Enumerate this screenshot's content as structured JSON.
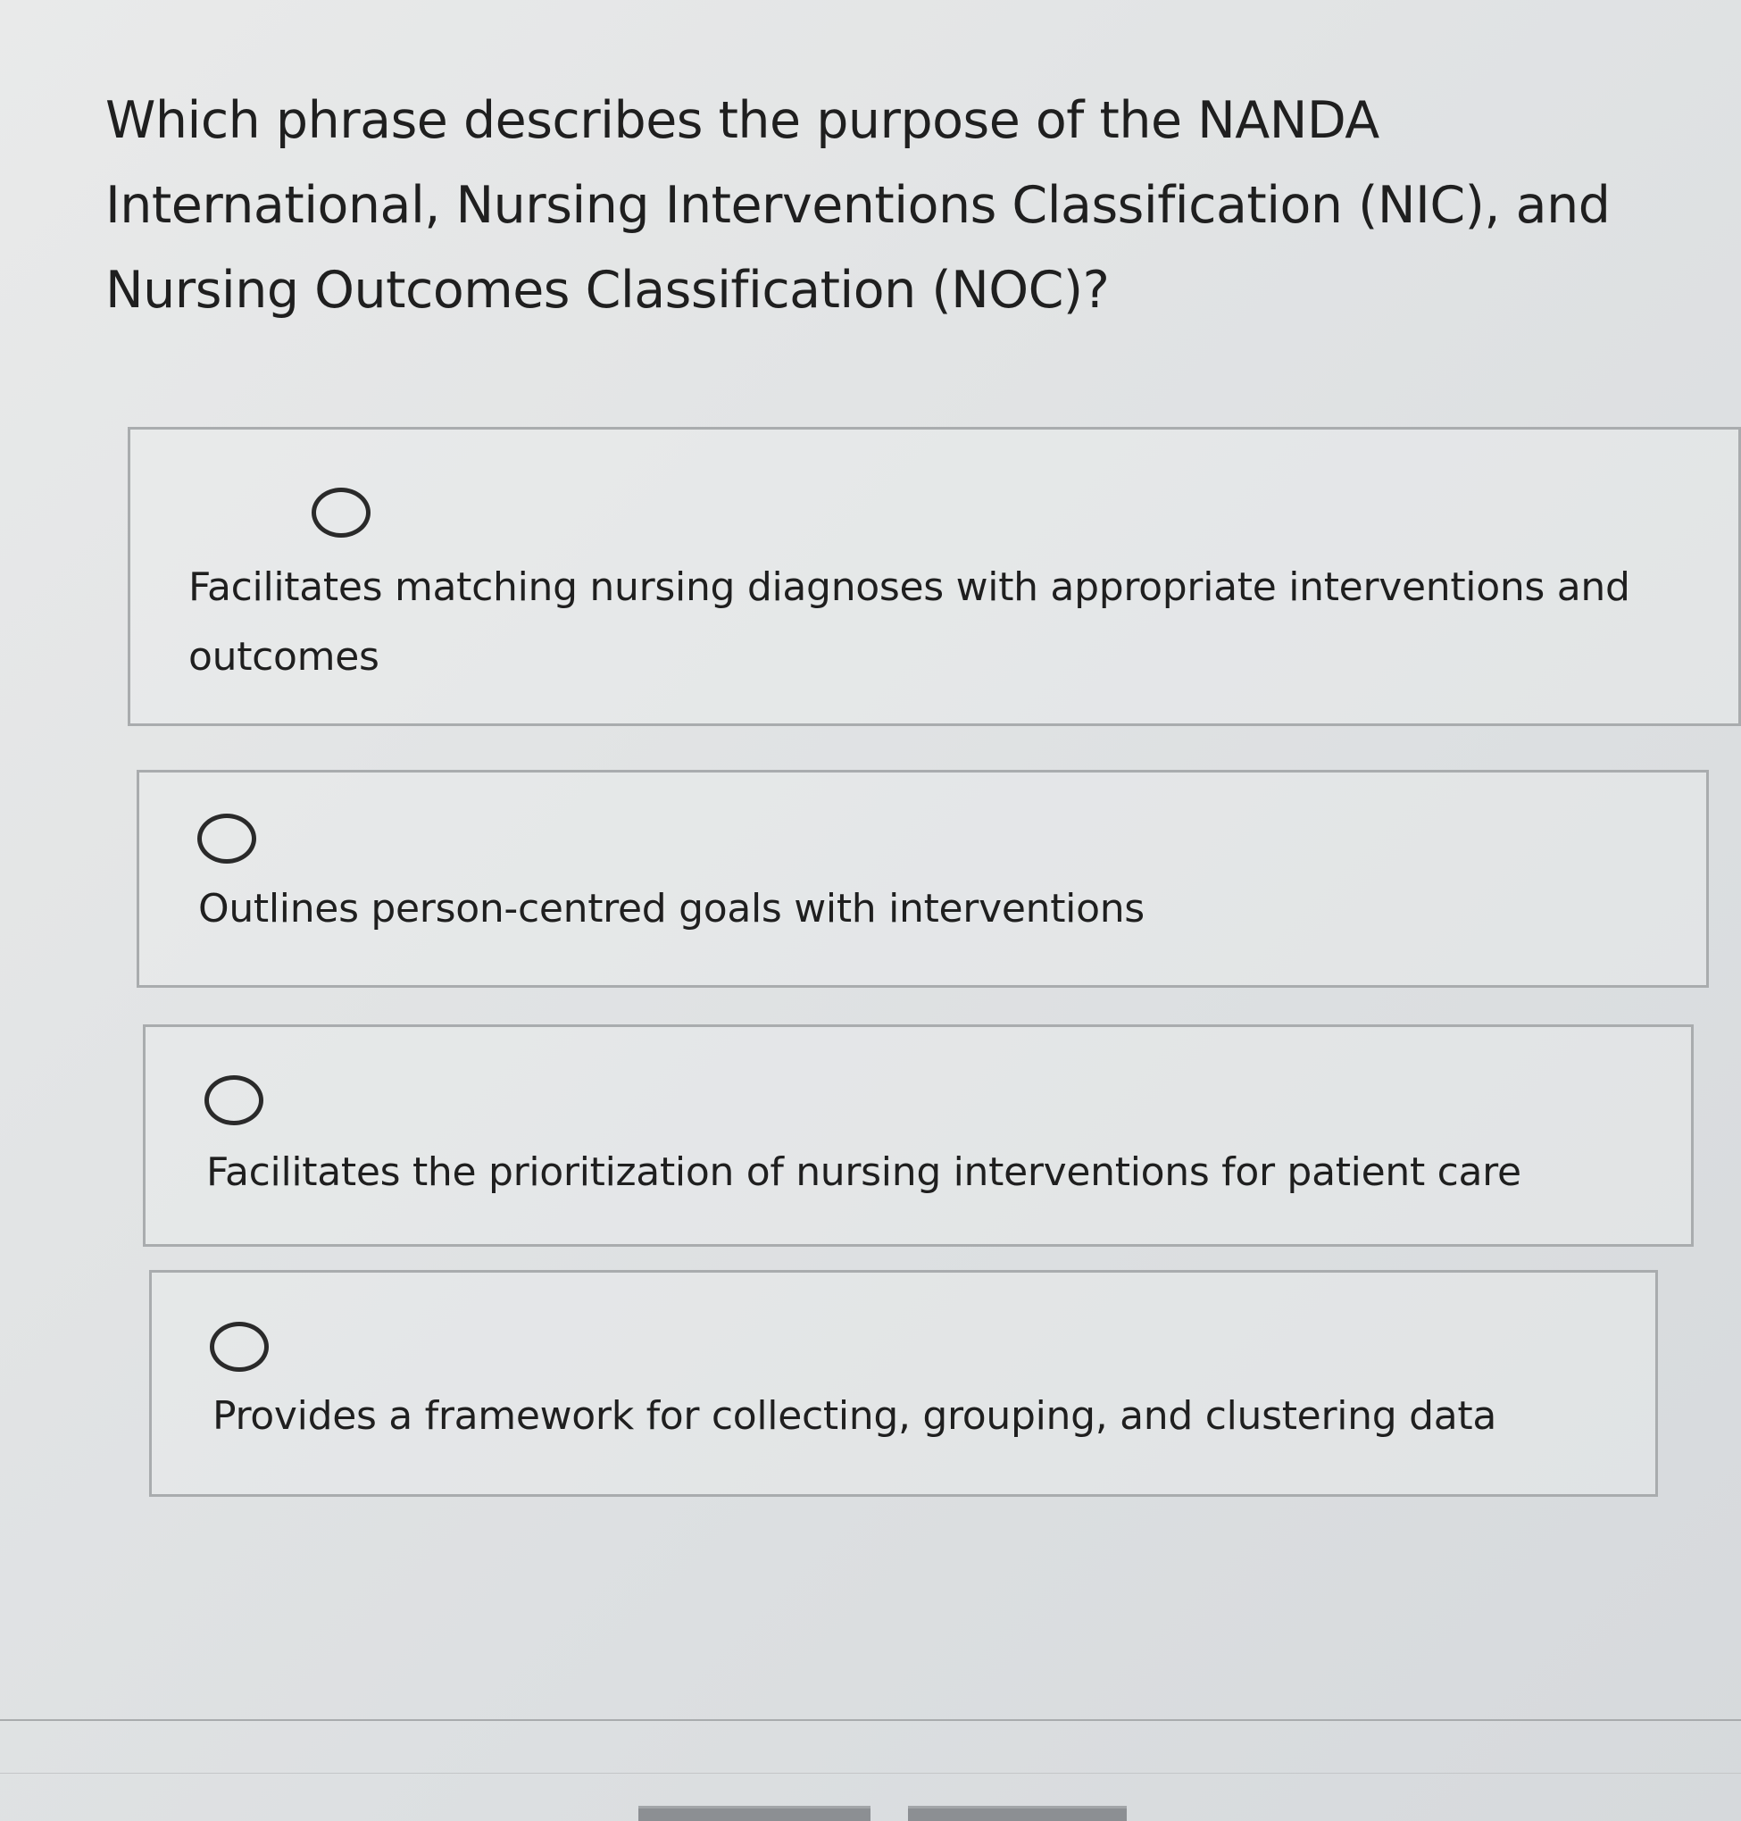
{
  "question": {
    "text": "Which phrase describes the purpose of the NANDA International, Nursing Interventions Classification (NIC), and Nursing Outcomes Classification (NOC)?"
  },
  "options": [
    {
      "label": "Facilitates matching nursing diagnoses with appropriate interventions and outcomes",
      "selected": false
    },
    {
      "label": "Outlines person-centred goals with interventions",
      "selected": false
    },
    {
      "label": "Facilitates the prioritization of nursing interventions for patient care",
      "selected": false
    },
    {
      "label": "Provides a framework for collecting, grouping, and clustering data",
      "selected": false
    }
  ],
  "colors": {
    "text": "#1f1f1f",
    "option_border": "#a9acae",
    "radio_border": "#2a2a2a",
    "background": "#e2e4e5"
  },
  "icons": {
    "radio": "radio-unselected-icon"
  }
}
